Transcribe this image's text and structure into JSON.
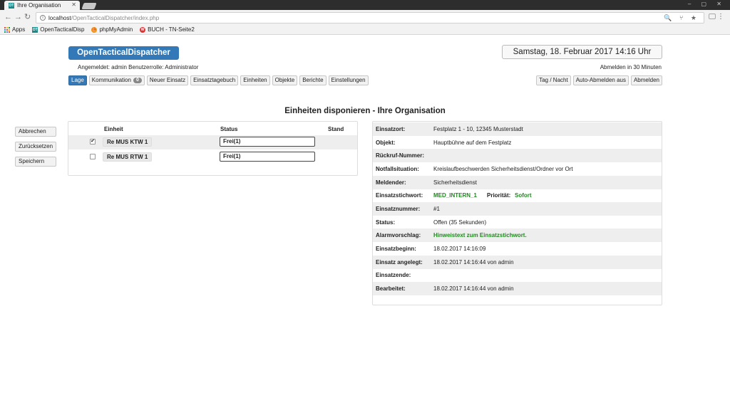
{
  "browser": {
    "tab_title": "Ihre Organisation",
    "url_host": "localhost",
    "url_path": "/OpenTacticalDispatcher/index.php",
    "bookmarks": [
      {
        "label": "Apps"
      },
      {
        "label": "OpenTacticalDisp"
      },
      {
        "label": "phpMyAdmin"
      },
      {
        "label": "BUCH - TN-Seite2"
      }
    ]
  },
  "header": {
    "brand": "OpenTacticalDispatcher",
    "datetime": "Samstag, 18. Februar 2017 14:16 Uhr",
    "logged_in": "Angemeldet: admin  Benutzerrolle: Administrator",
    "auto_logout": "Abmelden in 30 Minuten"
  },
  "nav": {
    "left": [
      {
        "label": "Lage",
        "active": true
      },
      {
        "label": "Kommunikation",
        "badge": "0"
      },
      {
        "label": "Neuer Einsatz"
      },
      {
        "label": "Einsatztagebuch"
      },
      {
        "label": "Einheiten"
      },
      {
        "label": "Objekte"
      },
      {
        "label": "Berichte"
      },
      {
        "label": "Einstellungen"
      }
    ],
    "right": [
      {
        "label": "Tag / Nacht"
      },
      {
        "label": "Auto-Abmelden aus"
      },
      {
        "label": "Abmelden"
      }
    ]
  },
  "page_title": "Einheiten disponieren - Ihre Organisation",
  "side_actions": {
    "cancel": "Abbrechen",
    "reset": "Zurücksetzen",
    "save": "Speichern"
  },
  "units_table": {
    "headers": {
      "unit": "Einheit",
      "status": "Status",
      "position": "Stand"
    },
    "rows": [
      {
        "checked": true,
        "unit": "Re MUS KTW 1",
        "status": "Frei(1)",
        "position": ""
      },
      {
        "checked": false,
        "unit": "Re MUS RTW 1",
        "status": "Frei(1)",
        "position": ""
      }
    ]
  },
  "incident": {
    "location": {
      "label": "Einsatzort:",
      "value": "Festplatz 1 - 10, 12345 Musterstadt"
    },
    "object": {
      "label": "Objekt:",
      "value": "Hauptbühne auf dem Festplatz"
    },
    "callback": {
      "label": "Rückruf-Nummer:",
      "value": ""
    },
    "emergency": {
      "label": "Notfallsituation:",
      "value": "Kreislaufbeschwerden Sicherheitsdienst/Ordner vor Ort"
    },
    "reporter": {
      "label": "Meldender:",
      "value": "Sicherheitsdienst"
    },
    "keyword": {
      "label": "Einsatzstichwort:",
      "value": "MED_INTERN_1",
      "priority_label": "Priorität:",
      "priority_value": "Sofort"
    },
    "number": {
      "label": "Einsatznummer:",
      "value": "#1"
    },
    "status": {
      "label": "Status:",
      "value": "Offen (35 Sekunden)"
    },
    "alarm": {
      "label": "Alarmvorschlag:",
      "value": "Hinweistext zum Einsatzstichwort."
    },
    "start": {
      "label": "Einsatzbeginn:",
      "value": "18.02.2017 14:16:09"
    },
    "created": {
      "label": "Einsatz angelegt:",
      "value": "18.02.2017 14:16:44 von admin"
    },
    "end": {
      "label": "Einsatzende:",
      "value": ""
    },
    "edited": {
      "label": "Bearbeitet:",
      "value": "18.02.2017 14:16:44 von admin"
    }
  },
  "colors": {
    "brand": "#3379b7",
    "accent_green": "#1e8a1e",
    "row_shade": "#eeeeee"
  }
}
